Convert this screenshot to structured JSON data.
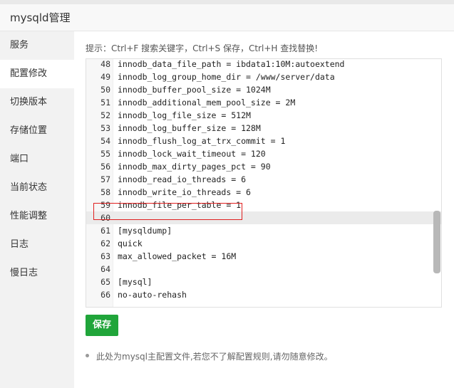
{
  "header": {
    "title": "mysqld管理"
  },
  "sidebar": {
    "items": [
      {
        "label": "服务"
      },
      {
        "label": "配置修改"
      },
      {
        "label": "切换版本"
      },
      {
        "label": "存储位置"
      },
      {
        "label": "端口"
      },
      {
        "label": "当前状态"
      },
      {
        "label": "性能调整"
      },
      {
        "label": "日志"
      },
      {
        "label": "慢日志"
      }
    ],
    "active_label": "配置修改"
  },
  "editor": {
    "hint": "提示：Ctrl+F 搜索关键字，Ctrl+S 保存，Ctrl+H 查找替换!",
    "lines": [
      {
        "num": "48",
        "code": "innodb_data_file_path = ibdata1:10M:autoextend"
      },
      {
        "num": "49",
        "code": "innodb_log_group_home_dir = /www/server/data"
      },
      {
        "num": "50",
        "code": "innodb_buffer_pool_size = 1024M"
      },
      {
        "num": "51",
        "code": "innodb_additional_mem_pool_size = 2M"
      },
      {
        "num": "52",
        "code": "innodb_log_file_size = 512M"
      },
      {
        "num": "53",
        "code": "innodb_log_buffer_size = 128M"
      },
      {
        "num": "54",
        "code": "innodb_flush_log_at_trx_commit = 1"
      },
      {
        "num": "55",
        "code": "innodb_lock_wait_timeout = 120"
      },
      {
        "num": "56",
        "code": "innodb_max_dirty_pages_pct = 90"
      },
      {
        "num": "57",
        "code": "innodb_read_io_threads = 6"
      },
      {
        "num": "58",
        "code": "innodb_write_io_threads = 6"
      },
      {
        "num": "59",
        "code": "innodb_file_per_table = 1"
      },
      {
        "num": "60",
        "code": ""
      },
      {
        "num": "61",
        "code": "[mysqldump]"
      },
      {
        "num": "62",
        "code": "quick"
      },
      {
        "num": "63",
        "code": "max_allowed_packet = 16M"
      },
      {
        "num": "64",
        "code": ""
      },
      {
        "num": "65",
        "code": "[mysql]"
      },
      {
        "num": "66",
        "code": "no-auto-rehash"
      }
    ],
    "current_line": "60",
    "highlighted_line": "59"
  },
  "actions": {
    "save_label": "保存"
  },
  "note": {
    "text": "此处为mysql主配置文件,若您不了解配置规则,请勿随意修改。"
  },
  "colors": {
    "accent": "#20a53a",
    "highlight_border": "#e02020"
  }
}
